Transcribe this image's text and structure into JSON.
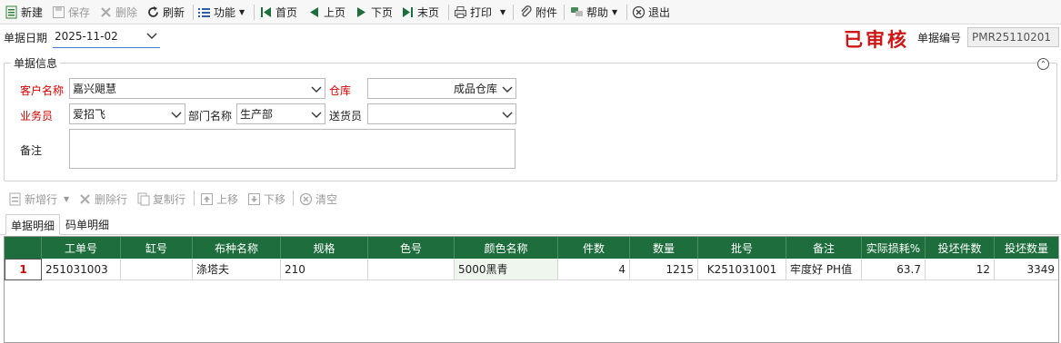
{
  "toolbar": {
    "new": "新建",
    "save": "保存",
    "delete": "删除",
    "refresh": "刷新",
    "function": "功能",
    "first": "首页",
    "prev": "上页",
    "next": "下页",
    "last": "末页",
    "print": "打印",
    "attach": "附件",
    "help": "帮助",
    "exit": "退出"
  },
  "header": {
    "date_label": "单据日期",
    "date_value": "2025-11-02",
    "stamp": "已审核",
    "docno_label": "单据编号",
    "docno_value": "PMR25110201"
  },
  "group": {
    "title": "单据信息",
    "customer_label": "客户名称",
    "customer_value": "嘉兴飓慧",
    "warehouse_label": "仓库",
    "warehouse_value": "成品仓库",
    "salesman_label": "业务员",
    "salesman_value": "爱招飞",
    "dept_label": "部门名称",
    "dept_value": "生产部",
    "deliverer_label": "送货员",
    "deliverer_value": "",
    "remark_label": "备注",
    "remark_value": ""
  },
  "rowbar": {
    "add_row": "新增行",
    "delete_row": "删除行",
    "copy_row": "复制行",
    "move_up": "上移",
    "move_down": "下移",
    "clear": "清空"
  },
  "tabs": [
    "单据明细",
    "码单明细"
  ],
  "grid": {
    "columns": [
      "",
      "工单号",
      "缸号",
      "布种名称",
      "规格",
      "色号",
      "颜色名称",
      "件数",
      "数量",
      "批号",
      "备注",
      "实际损耗%",
      "投坯件数",
      "投坯数量"
    ],
    "rows": [
      [
        "1",
        "251031003",
        "",
        "涤塔夫",
        "210",
        "",
        "5000黑青",
        "4",
        "1215",
        "K251031001",
        "牢度好  PH值",
        "63.7",
        "12",
        "3349"
      ]
    ]
  },
  "colors": {
    "header_green": "#1e6e3d",
    "stamp_red": "#d01515",
    "required_red": "#d40000"
  }
}
